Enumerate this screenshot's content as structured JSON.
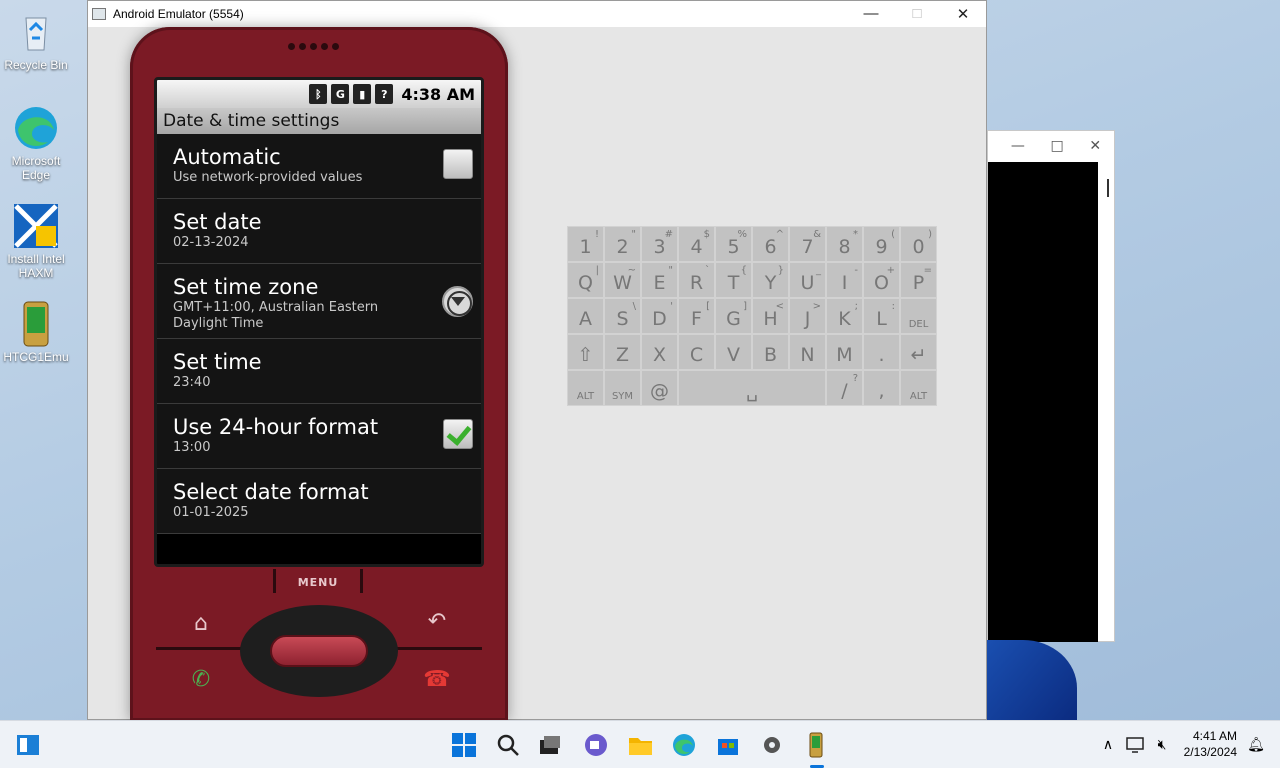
{
  "desktop": {
    "icons": [
      {
        "label": "Recycle Bin",
        "icon": "recycle-bin-icon"
      },
      {
        "label": "Microsoft Edge",
        "icon": "edge-icon"
      },
      {
        "label": "Install Intel HAXM",
        "icon": "installer-icon"
      },
      {
        "label": "HTCG1Emu",
        "icon": "phone-app-icon"
      }
    ]
  },
  "emulator": {
    "title": "Android Emulator (5554)",
    "status": {
      "time": "4:38 AM"
    },
    "screen_title": "Date & time settings",
    "settings": [
      {
        "title": "Automatic",
        "summary": "Use network-provided values",
        "checked": false
      },
      {
        "title": "Set date",
        "summary": "02-13-2024"
      },
      {
        "title": "Set time zone",
        "summary": "GMT+11:00, Australian Eastern Daylight Time"
      },
      {
        "title": "Set time",
        "summary": "23:40"
      },
      {
        "title": "Use 24-hour format",
        "summary": "13:00",
        "checked": true
      },
      {
        "title": "Select date format",
        "summary": "01-01-2025"
      }
    ],
    "menu_label": "MENU",
    "keyboard": {
      "row1": [
        "1",
        "2",
        "3",
        "4",
        "5",
        "6",
        "7",
        "8",
        "9",
        "0"
      ],
      "row1_alt": [
        "!",
        "\"",
        "#",
        "$",
        "%",
        "^",
        "&",
        "*",
        "(",
        ")"
      ],
      "row2": [
        "Q",
        "W",
        "E",
        "R",
        "T",
        "Y",
        "U",
        "I",
        "O",
        "P"
      ],
      "row2_alt": [
        "|",
        "~",
        "\"",
        "`",
        "{",
        "}",
        "_",
        "-",
        "+",
        "="
      ],
      "row3": [
        "A",
        "S",
        "D",
        "F",
        "G",
        "H",
        "J",
        "K",
        "L",
        "DEL"
      ],
      "row3_alt": [
        "",
        "\\",
        "'",
        "[",
        "]",
        "<",
        ">",
        ";",
        ":",
        ""
      ],
      "row4": [
        "⇧",
        "Z",
        "X",
        "C",
        "V",
        "B",
        "N",
        "M",
        ".",
        "↵"
      ],
      "row5": {
        "alt_left": "ALT",
        "sym": "SYM",
        "at": "@",
        "space": "␣",
        "slash": "/",
        "slash_alt": "?",
        "comma": ",",
        "alt_right": "ALT"
      }
    }
  },
  "taskbar": {
    "time": "4:41 AM",
    "date": "2/13/2024"
  }
}
